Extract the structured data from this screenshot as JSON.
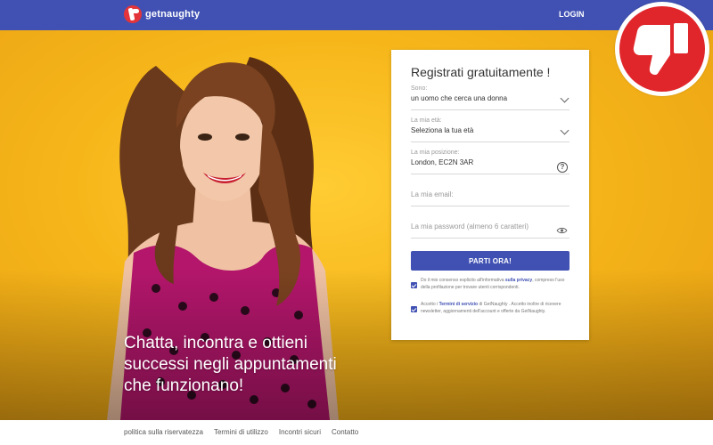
{
  "header": {
    "logo_text": "getnaughty",
    "login_label": "LOGIN",
    "bg_color": "#4051b3"
  },
  "hero": {
    "tagline_line1": "Chatta, incontra e ottieni",
    "tagline_line2": "successi negli appuntamenti",
    "tagline_line3": "che funzionano!"
  },
  "form": {
    "title": "Registrati gratuitamente !",
    "gender": {
      "label": "Sono:",
      "value": "un uomo che cerca una donna"
    },
    "age": {
      "label": "La mia età:",
      "value": "Seleziona la tua età"
    },
    "location": {
      "label": "La mia posizione:",
      "value": "London, EC2N 3AR",
      "help_icon": "?"
    },
    "email": {
      "placeholder": "La mia email:"
    },
    "password": {
      "placeholder": "La mia password (almeno 6 caratteri)"
    },
    "submit_label": "PARTI ORA!",
    "consent1": {
      "checked": true,
      "text_before": "Do il mio consenso esplicito all'informativa ",
      "link": "sulla privacy",
      "text_after": ", compreso l'uso della profilazione per trovare utenti corrispondenti."
    },
    "consent2": {
      "checked": true,
      "text_before": "Accetto i ",
      "link": "Termini di servizio",
      "text_after": " di GetNaughty . Accetto inoltre di ricevere newsletter, aggiornamenti dell'account e offerte da GetNaughty."
    }
  },
  "badge": {
    "icon": "thumbs-down-icon",
    "color": "#e0262b"
  },
  "footer": {
    "links": [
      "politica sulla riservatezza",
      "Termini di utilizzo",
      "Incontri sicuri",
      "Contatto"
    ]
  }
}
